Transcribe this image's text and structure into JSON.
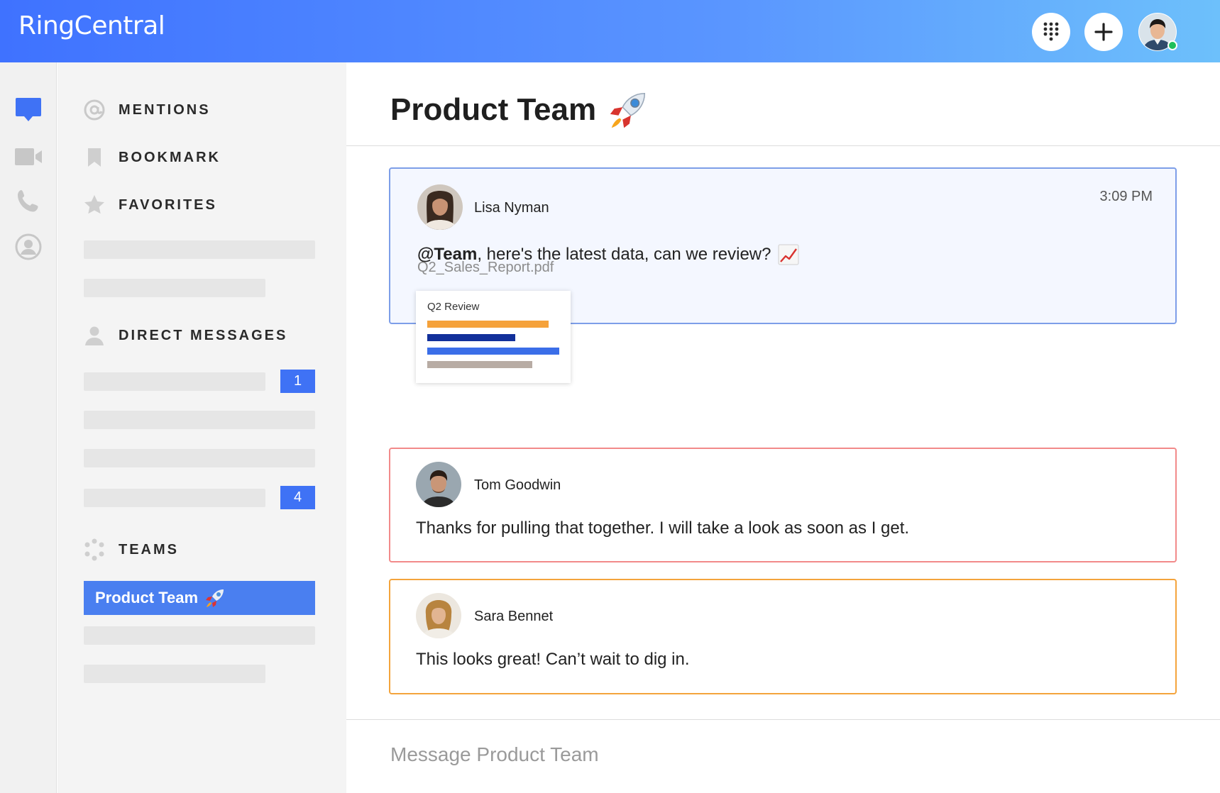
{
  "app": {
    "logo": "RingCentral"
  },
  "header": {
    "dialpad_icon": "dialpad-icon",
    "add_icon": "plus-icon",
    "avatar_status": "online"
  },
  "rail": {
    "items": [
      "messages-icon",
      "video-icon",
      "phone-icon",
      "contacts-icon"
    ]
  },
  "sidebar": {
    "mentions": "MENTIONS",
    "bookmark": "BOOKMARK",
    "favorites": "FAVORITES",
    "direct_messages": "DIRECT MESSAGES",
    "dm_badges": [
      "1",
      "4"
    ],
    "teams": "TEAMS",
    "active_team": "Product Team"
  },
  "conversation": {
    "title": "Product Team",
    "messages": [
      {
        "author": "Lisa Nyman",
        "time": "3:09 PM",
        "mention": "@Team",
        "text": ", here's the latest data, can we review?",
        "file": "Q2_Sales_Report.pdf",
        "preview_title": "Q2 Review"
      },
      {
        "author": "Tom Goodwin",
        "text": "Thanks for pulling that together. I will take a look as soon as I get."
      },
      {
        "author": "Sara Bennet",
        "text": "This looks great! Can’t wait to dig in."
      }
    ],
    "composer_placeholder": "Message Product Team"
  },
  "colors": {
    "header_start": "#3f72ff",
    "header_end": "#6dc0fb",
    "accent": "#3f72f5",
    "msg1_border": "#7d9ee8",
    "msg2_border": "#f28a8a",
    "msg3_border": "#f4a43c",
    "presence": "#1fbf5c"
  }
}
